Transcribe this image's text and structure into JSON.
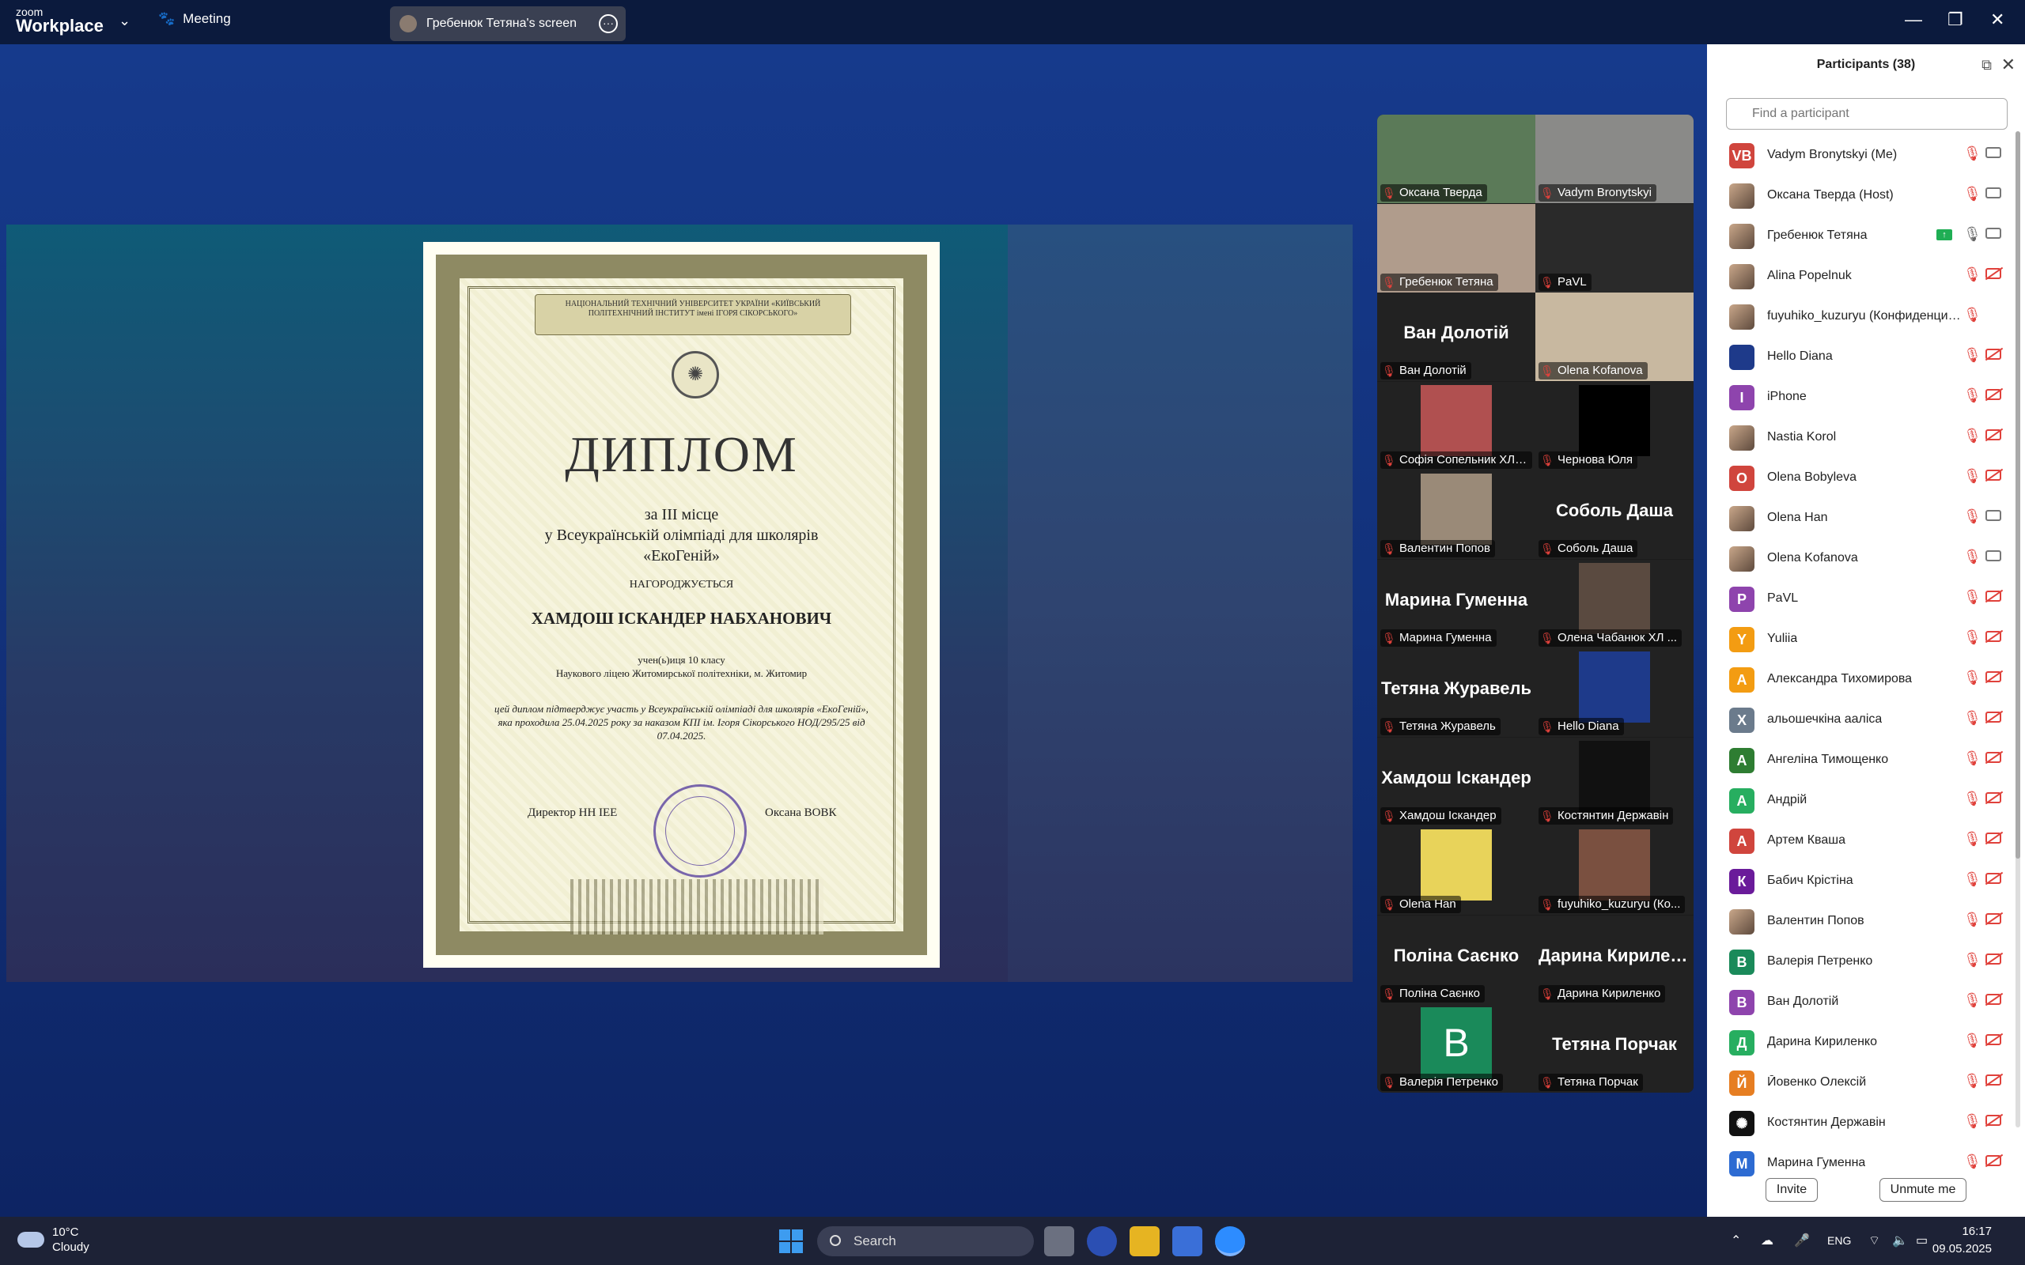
{
  "titlebar": {
    "logo_small": "zoom",
    "logo_big": "Workplace",
    "meeting_label": "Meeting",
    "share_label": "Гребенюк Тетяна's screen"
  },
  "diploma": {
    "banner": "НАЦІОНАЛЬНИЙ ТЕХНІЧНИЙ УНІВЕРСИТЕТ УКРАЇНИ «КИЇВСЬКИЙ ПОЛІТЕХНІЧНИЙ ІНСТИТУТ імені ІГОРЯ СІКОРСЬКОГО»",
    "title": "ДИПЛОМ",
    "place_line1": "за III місце",
    "place_line2": "у Всеукраїнській олімпіаді для школярів",
    "place_line3": "«ЕкоГеній»",
    "awarded": "НАГОРОДЖУЄТЬСЯ",
    "name": "ХАМДОШ ІСКАНДЕР НАБХАНОВИЧ",
    "class_line1": "учен(ь)иця 10 класу",
    "class_line2": "Наукового ліцею Житомирської політехніки, м. Житомир",
    "confirm": "цей диплом підтверджує участь у Всеукраїнській олімпіаді для школярів «ЕкоГеній», яка проходила 25.04.2025 року за наказом КПІ ім. Ігоря Сікорського НОД/295/25 від 07.04.2025.",
    "signer_left": "Директор НН ІЕЕ",
    "signer_right": "Оксана ВОВК"
  },
  "gallery": [
    {
      "label": "Оксана Тверда",
      "big": "",
      "video": "#5b7a58"
    },
    {
      "label": "Vadym Bronytskyi",
      "big": "",
      "video": "#8a8a88"
    },
    {
      "label": "Гребенюк Тетяна",
      "big": "",
      "video": "#b09c8c"
    },
    {
      "label": "PaVL",
      "big": "",
      "video": "#2a2a2a"
    },
    {
      "label": "Ван Долотій",
      "big": "Ван Долотій",
      "video": ""
    },
    {
      "label": "Olena Kofanova",
      "big": "",
      "video": "#c8b8a0"
    },
    {
      "label": "Софія Сопельник ХЛ ...",
      "big": "",
      "video": "",
      "thumb": "#b05050"
    },
    {
      "label": "Чернова Юля",
      "big": "",
      "video": "",
      "thumb": "#000000"
    },
    {
      "label": "Валентин Попов",
      "big": "",
      "video": "",
      "thumb": "#9a8a78"
    },
    {
      "label": "Соболь Даша",
      "big": "Соболь Даша",
      "video": ""
    },
    {
      "label": "Марина Гуменна",
      "big": "Марина Гуменна",
      "video": ""
    },
    {
      "label": "Олена Чабанюк ХЛ ...",
      "big": "",
      "video": "",
      "thumb": "#5a4a40"
    },
    {
      "label": "Тетяна Журавель",
      "big": "Тетяна Журавель",
      "video": ""
    },
    {
      "label": "Hello Diana",
      "big": "",
      "video": "",
      "thumb": "#1e3a8a"
    },
    {
      "label": "Хамдош Іскандер",
      "big": "Хамдош Іскандер",
      "video": ""
    },
    {
      "label": "Костянтин Державін",
      "big": "",
      "video": "",
      "thumb": "#111111"
    },
    {
      "label": "Olena Han",
      "big": "",
      "video": "",
      "thumb": "#e8d35a"
    },
    {
      "label": "fuyuhiko_kuzuryu (Ко...",
      "big": "",
      "video": "",
      "thumb": "#7a5040"
    },
    {
      "label": "Поліна Саєнко",
      "big": "Поліна Саєнко",
      "video": ""
    },
    {
      "label": "Дарина Кириленко",
      "big": "Дарина Кириленко",
      "video": ""
    },
    {
      "label": "Валерія Петренко",
      "big": "",
      "video": "",
      "thumb": "#1a8a5a",
      "letter": "B"
    },
    {
      "label": "Тетяна Порчак",
      "big": "Тетяна Порчак",
      "video": ""
    }
  ],
  "panel": {
    "title": "Participants (38)",
    "search_placeholder": "Find a participant",
    "invite": "Invite",
    "unmute": "Unmute me",
    "participants": [
      {
        "name": "Vadym Bronytskyi (Me)",
        "initials": "VB",
        "color": "#d0453d",
        "mic": "muted",
        "cam": "on"
      },
      {
        "name": "Оксана Тверда (Host)",
        "initials": "",
        "color": "photo",
        "mic": "muted",
        "cam": "on"
      },
      {
        "name": "Гребенюк Тетяна",
        "initials": "",
        "color": "photo",
        "mic": "on",
        "cam": "on",
        "share": true
      },
      {
        "name": "Alina Popelnuk",
        "initials": "",
        "color": "photo",
        "mic": "muted",
        "cam": "off"
      },
      {
        "name": "fuyuhiko_kuzuryu (Конфиденциальн...",
        "initials": "",
        "color": "photo",
        "mic": "muted",
        "cam": "none"
      },
      {
        "name": "Hello Diana",
        "initials": "",
        "color": "#1e3a8a",
        "mic": "muted",
        "cam": "off"
      },
      {
        "name": "iPhone",
        "initials": "I",
        "color": "#8e44ad",
        "mic": "muted",
        "cam": "off"
      },
      {
        "name": "Nastia Korol",
        "initials": "",
        "color": "photo",
        "mic": "muted",
        "cam": "off"
      },
      {
        "name": "Olena Bobyleva",
        "initials": "O",
        "color": "#d0453d",
        "mic": "muted",
        "cam": "off"
      },
      {
        "name": "Olena Han",
        "initials": "",
        "color": "photo",
        "mic": "muted",
        "cam": "on"
      },
      {
        "name": "Olena Kofanova",
        "initials": "",
        "color": "photo",
        "mic": "muted",
        "cam": "on"
      },
      {
        "name": "PaVL",
        "initials": "P",
        "color": "#8e44ad",
        "mic": "muted",
        "cam": "off"
      },
      {
        "name": "Yuliia",
        "initials": "Y",
        "color": "#f39c12",
        "mic": "muted",
        "cam": "off"
      },
      {
        "name": "Александра Тихомирова",
        "initials": "А",
        "color": "#f39c12",
        "mic": "muted",
        "cam": "off"
      },
      {
        "name": "альошечкіна ааліса",
        "initials": "X",
        "color": "#6b7b8c",
        "mic": "muted",
        "cam": "off"
      },
      {
        "name": "Ангеліна Тимощенко",
        "initials": "А",
        "color": "#2e7d32",
        "mic": "muted",
        "cam": "off"
      },
      {
        "name": "Андрій",
        "initials": "А",
        "color": "#27ae60",
        "mic": "muted",
        "cam": "off"
      },
      {
        "name": "Артем Кваша",
        "initials": "А",
        "color": "#d0453d",
        "mic": "muted",
        "cam": "off"
      },
      {
        "name": "Бабич Крістіна",
        "initials": "К",
        "color": "#6a1b9a",
        "mic": "muted",
        "cam": "off"
      },
      {
        "name": "Валентин Попов",
        "initials": "",
        "color": "photo",
        "mic": "muted",
        "cam": "off"
      },
      {
        "name": "Валерія Петренко",
        "initials": "B",
        "color": "#1a8a5a",
        "mic": "muted",
        "cam": "off"
      },
      {
        "name": "Ван Долотій",
        "initials": "В",
        "color": "#8e44ad",
        "mic": "muted",
        "cam": "off"
      },
      {
        "name": "Дарина Кириленко",
        "initials": "Д",
        "color": "#27ae60",
        "mic": "muted",
        "cam": "off"
      },
      {
        "name": "Йовенко Олексій",
        "initials": "Й",
        "color": "#e67e22",
        "mic": "muted",
        "cam": "off"
      },
      {
        "name": "Костянтин Державін",
        "initials": "✺",
        "color": "#111111",
        "mic": "muted",
        "cam": "off"
      },
      {
        "name": "Марина Гуменна",
        "initials": "М",
        "color": "#2d6bd2",
        "mic": "muted",
        "cam": "off"
      }
    ]
  },
  "taskbar": {
    "temp": "10°C",
    "condition": "Cloudy",
    "search": "Search",
    "lang": "ENG",
    "time": "16:17",
    "date": "09.05.2025"
  }
}
